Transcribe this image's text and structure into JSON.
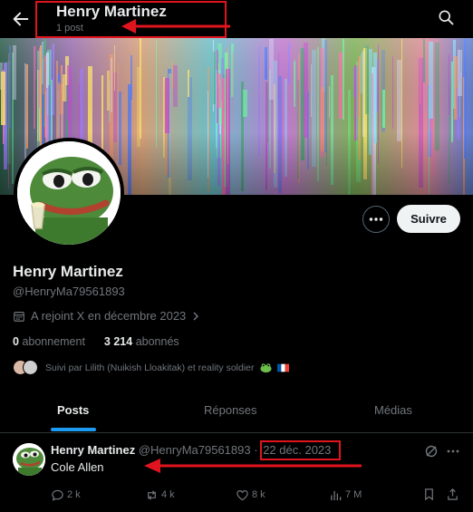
{
  "header": {
    "name": "Henry Martinez",
    "posts_count": "1 post"
  },
  "profile": {
    "name": "Henry Martinez",
    "handle": "@HenryMa79561893",
    "joined": "A rejoint X en décembre 2023",
    "following_count": "0",
    "following_label": "abonnement",
    "followers_count": "3 214",
    "followers_label": "abonnés",
    "followed_by": "Suivi par Lilith (Nuikish Lloakitak) et reality soldier",
    "follow_button": "Suivre"
  },
  "tabs": [
    {
      "label": "Posts"
    },
    {
      "label": "Réponses"
    },
    {
      "label": "Médias"
    }
  ],
  "tweet": {
    "name": "Henry Martinez",
    "handle": "@HenryMa79561893",
    "separator": "·",
    "date": "22 déc. 2023",
    "text": "Cole Allen",
    "replies": "2 k",
    "reposts": "4 k",
    "likes": "8 k",
    "views": "7 M"
  },
  "colors": {
    "accent": "#1d9bf0",
    "annotation": "#e0141e",
    "background": "#000000"
  }
}
